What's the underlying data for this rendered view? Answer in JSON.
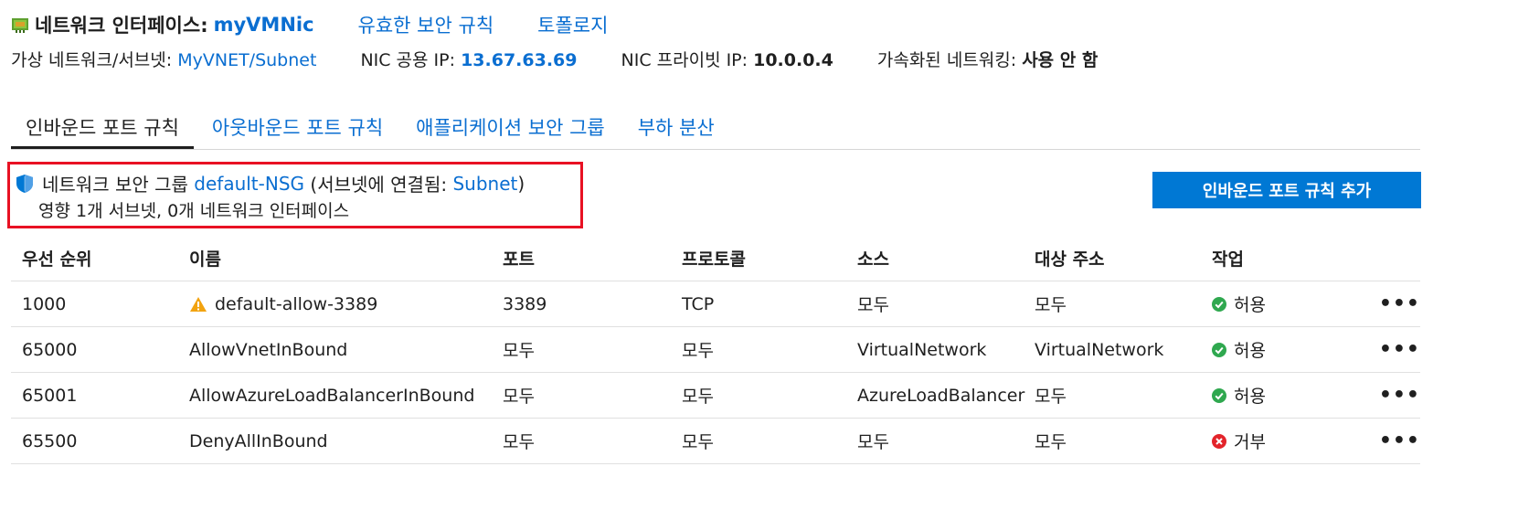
{
  "header": {
    "title_label": "네트워크 인터페이스:",
    "nic_name": "myVMNic",
    "links": [
      "유효한 보안 규칙",
      "토폴로지"
    ],
    "vnet_label": "가상 네트워크/서브넷:",
    "vnet_value": "MyVNET/Subnet",
    "public_ip_label": "NIC 공용 IP:",
    "public_ip_value": "13.67.63.69",
    "private_ip_label": "NIC 프라이빗 IP:",
    "private_ip_value": "10.0.0.4",
    "accel_label": "가속화된 네트워킹:",
    "accel_value": "사용 안 함"
  },
  "tabs": [
    {
      "label": "인바운드 포트 규칙",
      "active": true
    },
    {
      "label": "아웃바운드 포트 규칙",
      "active": false
    },
    {
      "label": "애플리케이션 보안 그룹",
      "active": false
    },
    {
      "label": "부하 분산",
      "active": false
    }
  ],
  "nsg": {
    "prefix": "네트워크 보안 그룹",
    "name": "default-NSG",
    "attached_prefix": "(서브넷에 연결됨:",
    "attached_value": "Subnet",
    "attached_suffix": ")",
    "impact": "영향 1개 서브넷, 0개 네트워크 인터페이스"
  },
  "add_button_label": "인바운드 포트 규칙 추가",
  "table": {
    "headers": [
      "우선 순위",
      "이름",
      "포트",
      "프로토콜",
      "소스",
      "대상 주소",
      "작업"
    ],
    "rows": [
      {
        "priority": "1000",
        "name": "default-allow-3389",
        "warning": true,
        "port": "3389",
        "protocol": "TCP",
        "source": "모두",
        "destination": "모두",
        "action": "허용",
        "allow": true
      },
      {
        "priority": "65000",
        "name": "AllowVnetInBound",
        "warning": false,
        "port": "모두",
        "protocol": "모두",
        "source": "VirtualNetwork",
        "destination": "VirtualNetwork",
        "action": "허용",
        "allow": true
      },
      {
        "priority": "65001",
        "name": "AllowAzureLoadBalancerInBound",
        "warning": false,
        "port": "모두",
        "protocol": "모두",
        "source": "AzureLoadBalancer",
        "destination": "모두",
        "action": "허용",
        "allow": true
      },
      {
        "priority": "65500",
        "name": "DenyAllInBound",
        "warning": false,
        "port": "모두",
        "protocol": "모두",
        "source": "모두",
        "destination": "모두",
        "action": "거부",
        "allow": false
      }
    ],
    "more_label": "•••"
  },
  "colors": {
    "link": "#0a6ed1",
    "button": "#0078d4",
    "highlight_border": "#e81123",
    "allow": "#2fa84f",
    "deny": "#e3242b",
    "warning": "#f2a310"
  }
}
